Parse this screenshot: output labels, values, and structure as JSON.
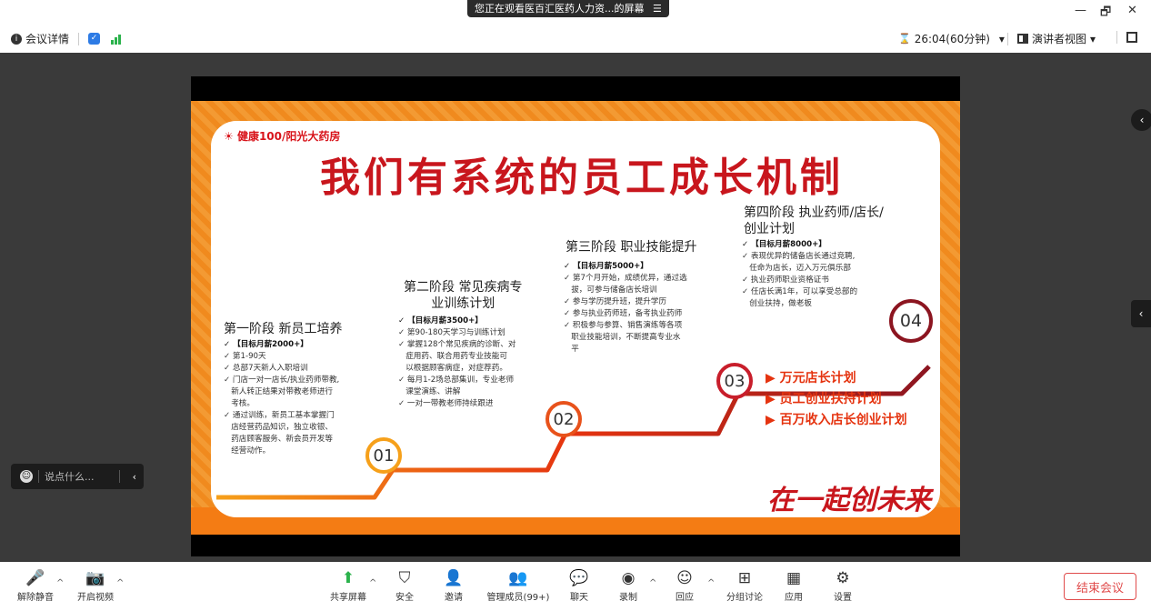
{
  "window": {
    "share_banner": "您正在观看医百汇医药人力资...的屏幕",
    "banner_menu_glyph": "☰",
    "minimize": "—",
    "restore": "🗗",
    "close": "✕"
  },
  "infobar": {
    "meeting_details": "会议详情",
    "timer": "26:04(60分钟)",
    "timer_caret": "▾",
    "view_mode": "演讲者视图",
    "view_caret": "▾"
  },
  "slide": {
    "brand": "健康100/阳光大药房",
    "headline": "我们有系统的员工成长机制",
    "stages": [
      {
        "title_lines": [
          "第一阶段 新员工培养"
        ],
        "bullets": [
          "✓ 【目标月薪2000+】",
          "✓ 第1-90天",
          "✓ 总部7天新人入职培训",
          "✓ 门店一对一店长/执业药师带教,",
          "   新人转正结果对带教老师进行",
          "   考核。",
          "✓ 通过训练，新员工基本掌握门",
          "   店经营药品知识，独立收银、",
          "   药店顾客服务、新会员开发等",
          "   经营动作。"
        ],
        "number": "01"
      },
      {
        "title_lines": [
          "第二阶段 常见疾病专",
          "业训练计划"
        ],
        "bullets": [
          "✓ 【目标月薪3500+】",
          "✓ 第90-180天学习与训练计划",
          "✓ 掌握128个常见疾病的诊断、对",
          "   症用药、联合用药专业技能可",
          "   以根据顾客病症，对症荐药。",
          "✓ 每月1-2场总部集训，专业老师",
          "   课堂演练、讲解",
          "✓ 一对一带教老师持续跟进"
        ],
        "number": "02"
      },
      {
        "title_lines": [
          "第三阶段 职业技能提升"
        ],
        "bullets": [
          "✓ 【目标月薪5000+】",
          "✓ 第7个月开始，成绩优异，通过选",
          "   拔，可参与储备店长培训",
          "✓ 参与学历提升班，提升学历",
          "✓ 参与执业药师班，备考执业药师",
          "✓ 积极参与参算、销售演练等各项",
          "   职业技能培训，不断提高专业水",
          "   平"
        ],
        "number": "03"
      },
      {
        "title_lines": [
          "第四阶段  执业药师/店长/",
          "创业计划"
        ],
        "bullets": [
          "✓ 【目标月薪8000+】",
          "✓ 表现优异的储备店长通过竞聘,",
          "   任命为店长，迈入万元俱乐部",
          "✓ 执业药师职业资格证书",
          "✓ 任店长满1年，可以享受总部的",
          "   创业扶持，做老板"
        ],
        "number": "04"
      }
    ],
    "plans": [
      "▶ 万元店长计划",
      "▶ 员工创业扶持计划",
      "▶ 百万收入店长创业计划"
    ],
    "slogan": "在一起创未来"
  },
  "chat": {
    "placeholder": "说点什么...",
    "collapse": "‹"
  },
  "side_tabs": {
    "top": "‹",
    "middle": "‹"
  },
  "toolbar": {
    "left": [
      {
        "label": "解除静音",
        "icon": "mic-muted-icon",
        "glyph": "🎤"
      },
      {
        "label": "开启视频",
        "icon": "video-off-icon",
        "glyph": "📷"
      }
    ],
    "center": [
      {
        "label": "共享屏幕",
        "icon": "share-screen-icon",
        "glyph": "⬆"
      },
      {
        "label": "安全",
        "icon": "shield-icon",
        "glyph": "⛉"
      },
      {
        "label": "邀请",
        "icon": "invite-icon",
        "glyph": "👤"
      },
      {
        "label": "管理成员(99+)",
        "icon": "members-icon",
        "glyph": "👥"
      },
      {
        "label": "聊天",
        "icon": "chat-icon",
        "glyph": "💬"
      },
      {
        "label": "录制",
        "icon": "record-icon",
        "glyph": "◉"
      },
      {
        "label": "回应",
        "icon": "reaction-icon",
        "glyph": "☺"
      },
      {
        "label": "分组讨论",
        "icon": "breakout-icon",
        "glyph": "⊞"
      },
      {
        "label": "应用",
        "icon": "apps-icon",
        "glyph": "▦"
      },
      {
        "label": "设置",
        "icon": "gear-icon",
        "glyph": "⚙"
      }
    ],
    "caret": "^",
    "end_meeting": "结束会议"
  },
  "colors": {
    "accent_red": "#c8161d",
    "slide_orange": "#f47c14",
    "stage_bg": "#3a3a3a",
    "end_red": "#e04b4b"
  }
}
